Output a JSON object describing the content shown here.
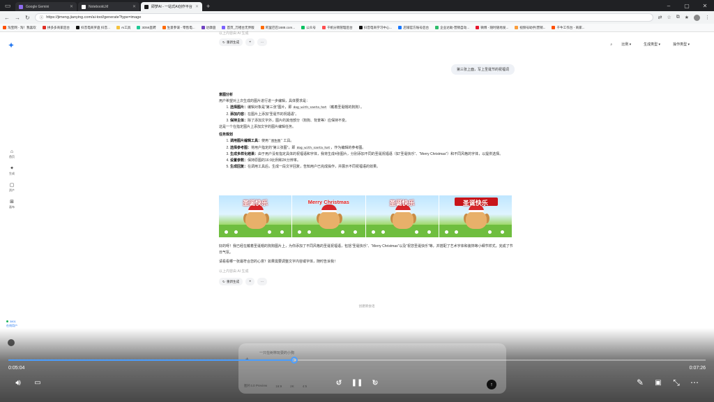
{
  "browser": {
    "tabs": [
      {
        "title": "Google Gemini",
        "color": "#8e6cf0",
        "active": false
      },
      {
        "title": "NotebookLM",
        "color": "#ffffff",
        "active": false
      },
      {
        "title": "即梦AI - 一站式AI创作平台",
        "color": "#1a1a1a",
        "active": true
      }
    ],
    "url": "https://jimeng.jianying.com/ai-tool/generate?type=image",
    "bookmarks": [
      {
        "label": "淘宝网 - 淘！我喜欢",
        "color": "#ff5000"
      },
      {
        "label": "拼多多商家后台",
        "color": "#e02e24"
      },
      {
        "label": "抖音电商罗盘 抖音...",
        "color": "#111111"
      },
      {
        "label": "AI工具",
        "color": "#f5c23e"
      },
      {
        "label": "3D56直聘",
        "color": "#20c997"
      },
      {
        "label": "生意参谋 - 零售电...",
        "color": "#ff6a00"
      },
      {
        "label": "达摩盘",
        "color": "#6f42c1"
      },
      {
        "label": "首页_万相台无界版",
        "color": "#7b61ff"
      },
      {
        "label": "阿里巴巴1688.com...",
        "color": "#ff6a00"
      },
      {
        "label": "公众号",
        "color": "#07c160"
      },
      {
        "label": "千帆分销管理后台",
        "color": "#ff4d4f"
      },
      {
        "label": "抖音电商学习中心...",
        "color": "#111111"
      },
      {
        "label": "店铺官方账号后台",
        "color": "#1677ff"
      },
      {
        "label": "企业达助-营销自动...",
        "color": "#2ebd6b"
      },
      {
        "label": "微博 - 随时随地发...",
        "color": "#e6162d"
      },
      {
        "label": "视频号助手|营销...",
        "color": "#fa9d3b"
      },
      {
        "label": "千牛工作台 - 商家...",
        "color": "#ff5000"
      }
    ]
  },
  "app": {
    "top_controls": [
      "比例",
      "生成类型",
      "操作类型"
    ],
    "sidebar": [
      {
        "label": "首页",
        "icon": "home-icon",
        "glyph": "⌂"
      },
      {
        "label": "生成",
        "icon": "sparkle-icon",
        "glyph": "✦"
      },
      {
        "label": "资产",
        "icon": "folder-icon",
        "glyph": "▢"
      },
      {
        "label": "画布",
        "icon": "grid-icon",
        "glyph": "⊞"
      }
    ],
    "prev_note": "以上内容由 AI 生成",
    "actions": {
      "regen": "重新生成",
      "quote": "❝",
      "more": "···"
    },
    "user_message": "第三张上面，写上圣诞节的祝福词",
    "intent_title": "意图分析",
    "intent_intro": "用户希望对上次生成的图片进行进一步编辑，具体要求是：",
    "intent_items": [
      {
        "k": "选择图片：",
        "v": "编辑对象是“第三张”图片，即 ",
        "code": "dog_with_santa_hat",
        "tail": "（戴着圣诞帽的狗狗）。"
      },
      {
        "k": "添加内容：",
        "v": "在图片上添加“圣诞节的祝福语”。",
        "code": "",
        "tail": ""
      },
      {
        "k": "保持主体：",
        "v": "除了添加文字外，图片的其他部分（狗狗、背景等）应保持不变。",
        "code": "",
        "tail": ""
      }
    ],
    "intent_outro": "这是一个在指定图片上添加文字的图片编辑任务。",
    "plan_title": "任务规划",
    "plan_items": [
      {
        "k": "调用图片编辑工具：",
        "v": "使用 “",
        "code": "图生图",
        "tail": "” 工具。"
      },
      {
        "k": "选择参考图：",
        "v": "将用户指定的“第三张图”，即 ",
        "code": "dog_with_santa_hat",
        "tail": "，作为编辑的参考图。"
      },
      {
        "k": "生成多样化结果：",
        "v": "由于用户没有指定具体的祝福语和字体，我将生成4张图片，分别添加不同的圣诞祝福语（如“圣诞快乐”、“Merry Christmas”）和不同风格的字体，以提供选择。",
        "code": "",
        "tail": ""
      },
      {
        "k": "设置参数：",
        "v": "保持原图的16:9比例和2K分辨率。",
        "code": "",
        "tail": ""
      },
      {
        "k": "生成回复：",
        "v": "在调用工具后，生成一段文字回复，告知用户已完成操作，并展示不同祝福语的效果。",
        "code": "",
        "tail": ""
      }
    ],
    "images": [
      {
        "caption": "圣诞快乐",
        "style": "cn"
      },
      {
        "caption": "Merry Christmas",
        "style": "en"
      },
      {
        "caption": "圣诞快乐",
        "style": "cn"
      },
      {
        "caption": "圣诞快乐",
        "style": "ribbon"
      }
    ],
    "result_text": "好的呀！我已经在戴着圣诞帽的狗狗图片上，为你添加了不同风格的圣诞祝福语，包括“圣诞快乐”、“Merry Christmas”以及“祝您圣诞快乐”等，并搭配了艺术字体和装饰等小细节样式，完成了节日气氛。",
    "followup": "请看看哪一张最符合您的心意？如果需要调整文字内容或字体，随时告诉我！",
    "ai_note": "以上内容由 AI 生成",
    "divider_note": "创建新会话",
    "online": {
      "count": "3801",
      "label": "在线用户"
    },
    "composer": {
      "placeholder": "一只在树林玩耍的小狗",
      "tools": [
        "图片4.0 Preview",
        "16:9",
        "2K",
        "4:5"
      ]
    }
  },
  "player": {
    "current": "0:05:04",
    "duration": "0:07:26",
    "progress": 0.41,
    "seek_back": "10",
    "seek_fwd": "30"
  }
}
